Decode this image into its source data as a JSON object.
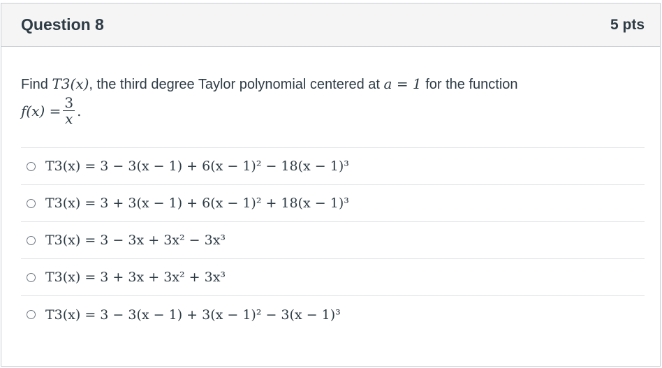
{
  "question": {
    "title": "Question 8",
    "points": "5 pts",
    "prompt": {
      "find": "Find",
      "T3x": "T3(x)",
      "middle": ", the third degree Taylor polynomial centered at",
      "a_eq": "a = 1",
      "tail": "for the function",
      "f_lhs": "f(x) =",
      "frac_num": "3",
      "frac_den": "x",
      "end": "."
    }
  },
  "answers": [
    {
      "label": "T3(x) = 3 − 3(x − 1) + 6(x − 1)² − 18(x − 1)³"
    },
    {
      "label": "T3(x) = 3 + 3(x − 1) + 6(x − 1)² + 18(x − 1)³"
    },
    {
      "label": "T3(x) = 3 − 3x + 3x² − 3x³"
    },
    {
      "label": "T3(x) = 3 + 3x + 3x² + 3x³"
    },
    {
      "label": "T3(x) = 3 − 3(x − 1) + 3(x − 1)² − 3(x − 1)³"
    }
  ]
}
